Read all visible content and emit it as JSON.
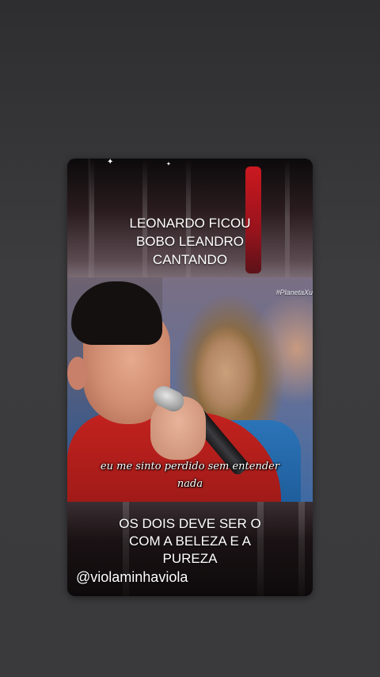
{
  "story": {
    "title_lines": [
      "LEONARDO FICOU",
      "BOBO LEANDRO",
      "CANTANDO"
    ],
    "watermark": "#PlanetaXu",
    "lyric_lines": [
      "eu me sinto perdido sem entender",
      "nada"
    ],
    "caption_lines": [
      "OS DOIS DEVE SER O",
      "COM A BELEZA E A",
      "PUREZA"
    ],
    "handle": "@violaminhaviola"
  },
  "colors": {
    "background": "#3a3a3c",
    "card_dark": "#140d0e",
    "accent_red": "#e01a22",
    "text": "#ffffff"
  }
}
